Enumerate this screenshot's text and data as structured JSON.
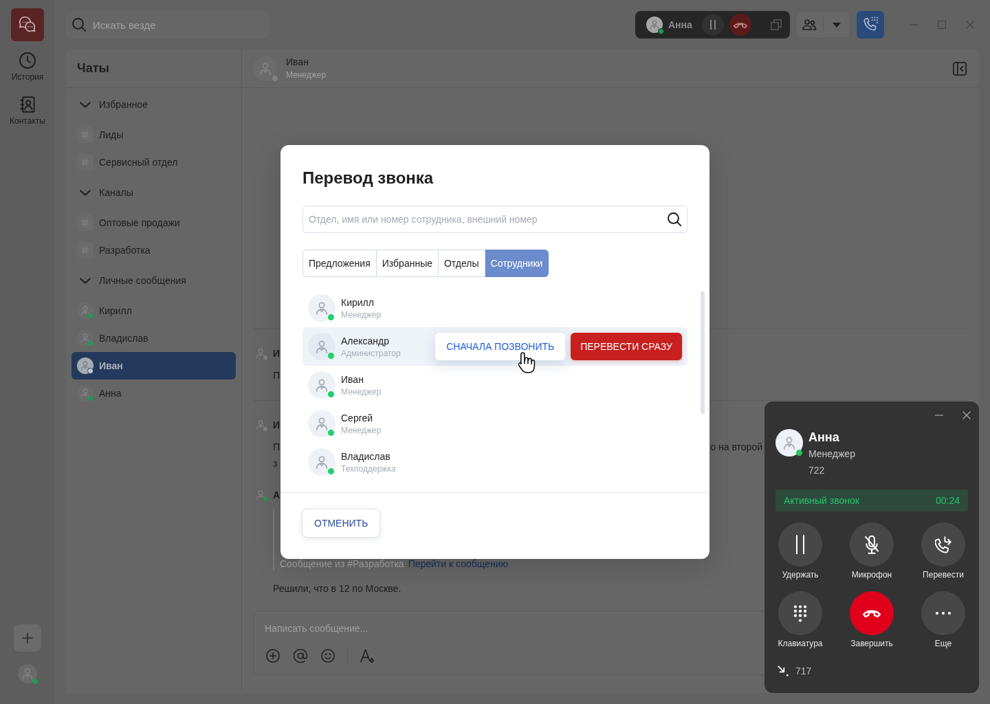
{
  "rail": {
    "items": [
      {
        "label": "История",
        "selected": false
      },
      {
        "label": "Контакты",
        "selected": false
      }
    ],
    "user": {
      "online": true
    }
  },
  "top_bar": {
    "search": {
      "placeholder": "Искать везде"
    },
    "call": {
      "name": "Анна",
      "online": true
    }
  },
  "sidebar": {
    "title": "Чаты",
    "groups": [
      {
        "label": "Избранное",
        "expanded": true,
        "children": [
          {
            "label": "Лиды",
            "kind": "channel",
            "selected": false
          },
          {
            "label": "Сервисный отдел",
            "kind": "channel",
            "selected": false
          }
        ]
      },
      {
        "label": "Каналы",
        "expanded": true,
        "children": [
          {
            "label": "Оптовые продажи",
            "kind": "channel",
            "selected": false
          },
          {
            "label": "Разработка",
            "kind": "channel",
            "selected": false
          }
        ]
      },
      {
        "label": "Личные сообщения",
        "expanded": true,
        "children": [
          {
            "label": "Кирилл",
            "kind": "person",
            "online": true,
            "selected": false
          },
          {
            "label": "Владислав",
            "kind": "person",
            "online": true,
            "selected": false
          },
          {
            "label": "Иван",
            "kind": "person",
            "online": false,
            "selected": true
          },
          {
            "label": "Анна",
            "kind": "person",
            "online": true,
            "selected": false
          }
        ]
      }
    ]
  },
  "chat": {
    "header": {
      "name": "Иван",
      "role": "Менеджер",
      "online": false
    },
    "messages": [
      {
        "author": "И",
        "online": false,
        "divider_above": true,
        "lines": [
          [
            "П"
          ]
        ]
      },
      {
        "author": "И",
        "online": false,
        "divider_above": true,
        "lines": [
          [
            "П",
            "о на второй"
          ],
          [
            "з"
          ]
        ]
      },
      {
        "author": "А",
        "online": true,
        "divider_above": false,
        "quote": {
          "source": "Сообщение из #Разработка",
          "link": "Перейти к сообщению"
        },
        "lines": [
          [
            "Решили, что в 12 по Москве."
          ]
        ]
      }
    ],
    "composer": {
      "placeholder": "Написать сообщение..."
    }
  },
  "modal": {
    "title": "Перевод звонка",
    "search": {
      "placeholder": "Отдел, имя или номер сотрудника, внешний номер"
    },
    "tabs": [
      {
        "label": "Предложения",
        "selected": false
      },
      {
        "label": "Избранные",
        "selected": false
      },
      {
        "label": "Отделы",
        "selected": false
      },
      {
        "label": "Сотрудники",
        "selected": true
      }
    ],
    "rows": [
      {
        "name": "Кирилл",
        "role": "Менеджер",
        "online": true,
        "hovered": false
      },
      {
        "name": "Александр",
        "role": "Администратор",
        "online": true,
        "hovered": true,
        "actions": [
          {
            "label": "СНАЧАЛА ПОЗВОНИТЬ",
            "kind": "call_first"
          },
          {
            "label": "ПЕРЕВЕСТИ СРАЗУ",
            "kind": "transfer_now"
          }
        ]
      },
      {
        "name": "Иван",
        "role": "Менеджер",
        "online": true,
        "hovered": false
      },
      {
        "name": "Сергей",
        "role": "Менеджер",
        "online": true,
        "hovered": false
      },
      {
        "name": "Владислав",
        "role": "Техподдержка",
        "online": true,
        "hovered": false
      }
    ],
    "cancel": "ОТМЕНИТЬ"
  },
  "call_panel": {
    "name": "Анна",
    "role": "Менеджер",
    "number": "722",
    "online": true,
    "status": "Активный звонок",
    "timer": "00:24",
    "buttons": [
      {
        "label": "Удержать",
        "kind": "hold"
      },
      {
        "label": "Микрофон",
        "kind": "mic"
      },
      {
        "label": "Перевести",
        "kind": "transfer"
      },
      {
        "label": "Клавиатура",
        "kind": "keypad"
      },
      {
        "label": "Завершить",
        "kind": "end"
      },
      {
        "label": "Еще",
        "kind": "more"
      }
    ],
    "incoming_number": "717"
  }
}
